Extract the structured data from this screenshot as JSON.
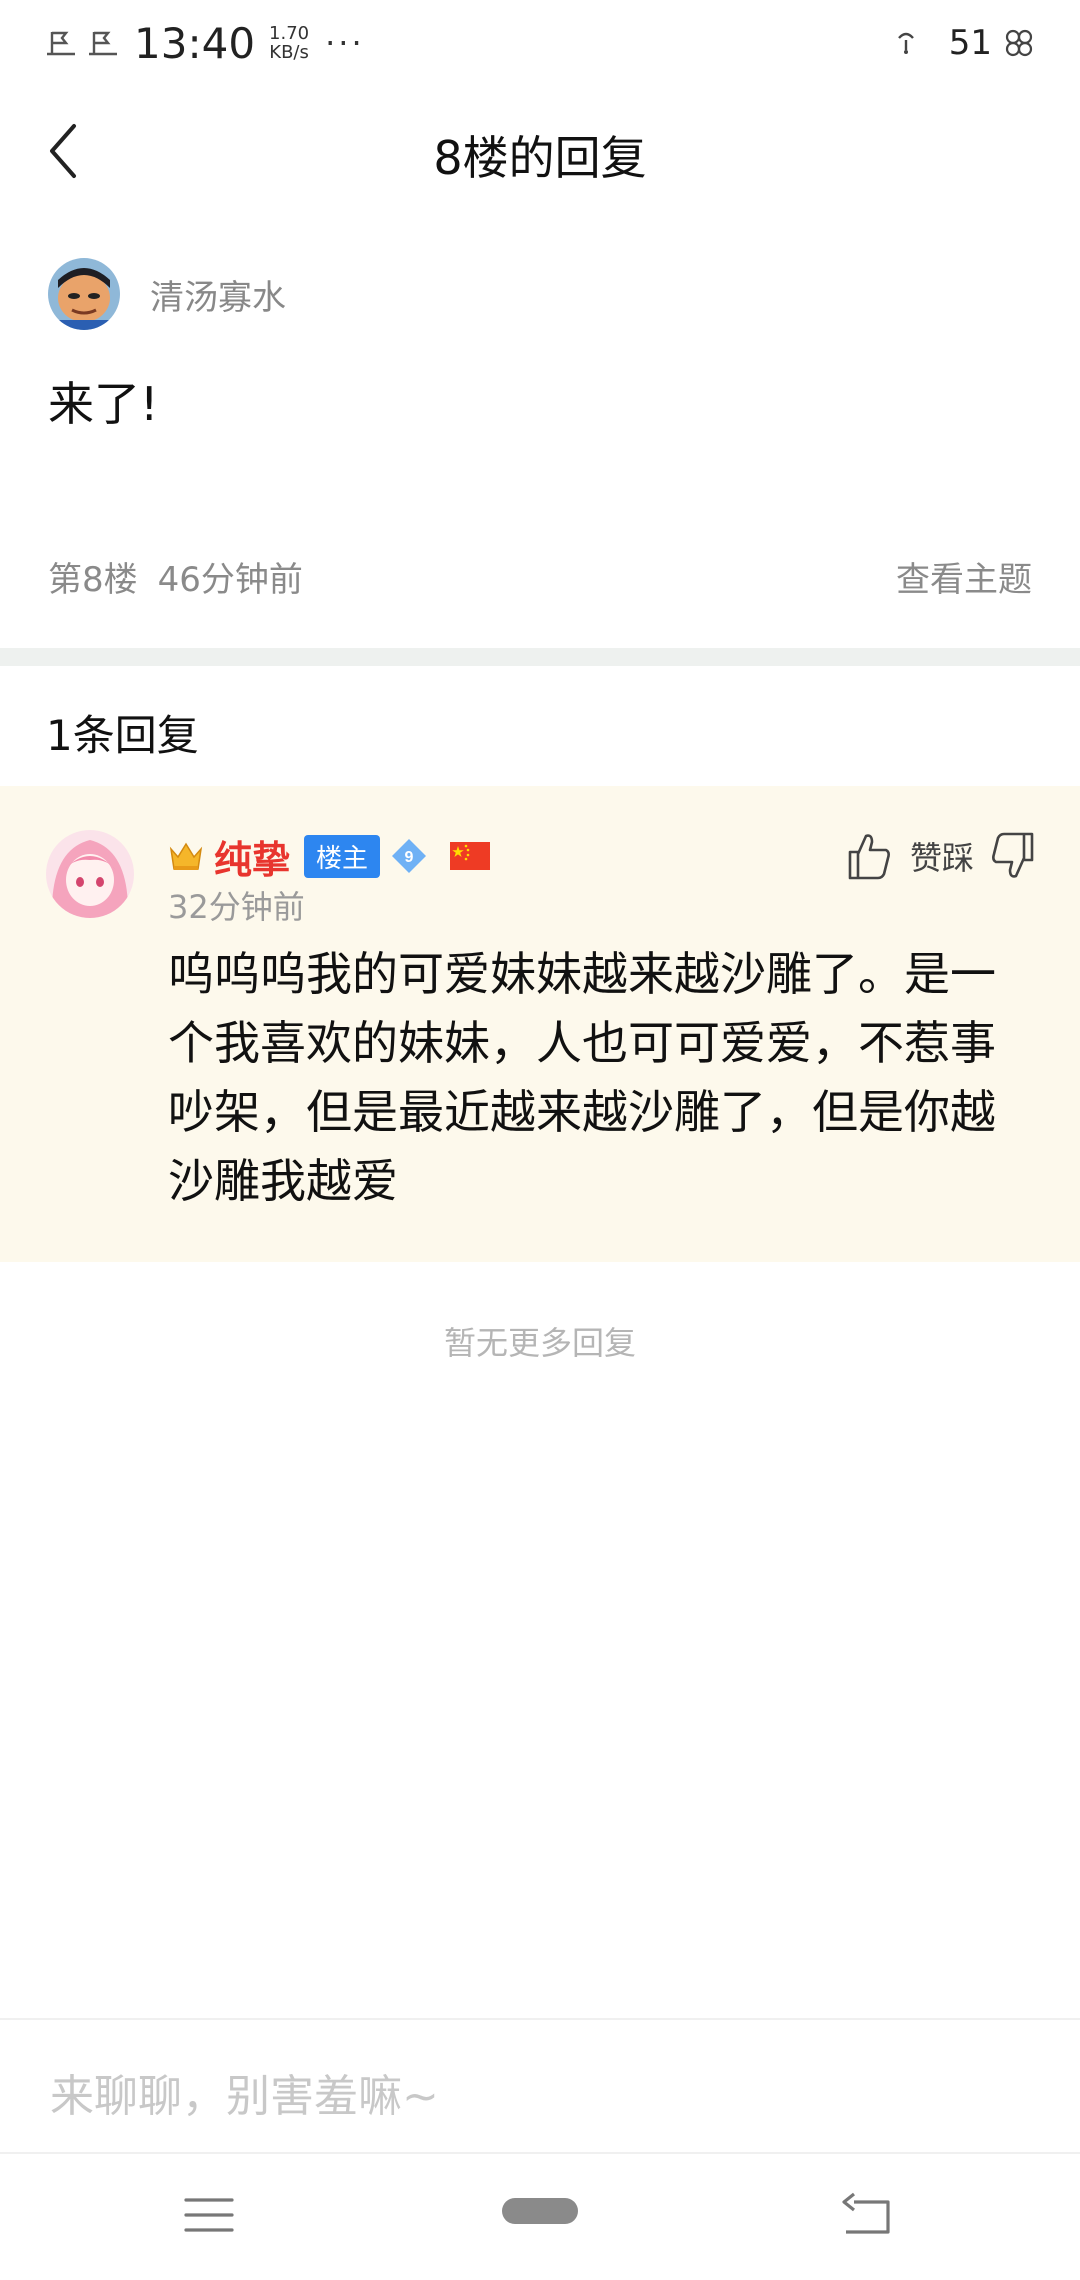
{
  "status_bar": {
    "time": "13:40",
    "speed_value": "1.70",
    "speed_unit": "KB/s",
    "more": "···",
    "battery": "51"
  },
  "header": {
    "title": "8楼的回复"
  },
  "floor_post": {
    "author": "清汤寡水",
    "content": "来了!",
    "floor": "第8楼",
    "time_ago": "46分钟前",
    "view_topic": "查看主题"
  },
  "replies": {
    "count_label": "1条回复",
    "items": [
      {
        "name": "纯挚",
        "badge": "楼主",
        "level": "9",
        "time_ago": "32分钟前",
        "vote_label": "赞踩",
        "content": "呜呜呜我的可爱妹妹越来越沙雕了。是一个我喜欢的妹妹，人也可可爱爱，不惹事吵架，但是最近越来越沙雕了，但是你越沙雕我越爱"
      }
    ],
    "no_more": "暂无更多回复"
  },
  "input": {
    "placeholder": "来聊聊，别害羞嘛~"
  },
  "colors": {
    "accent_red": "#e8352e",
    "badge_blue": "#2d86f0",
    "reply_bg": "#fdf9ec",
    "meta_gray": "#8a8a8a"
  }
}
